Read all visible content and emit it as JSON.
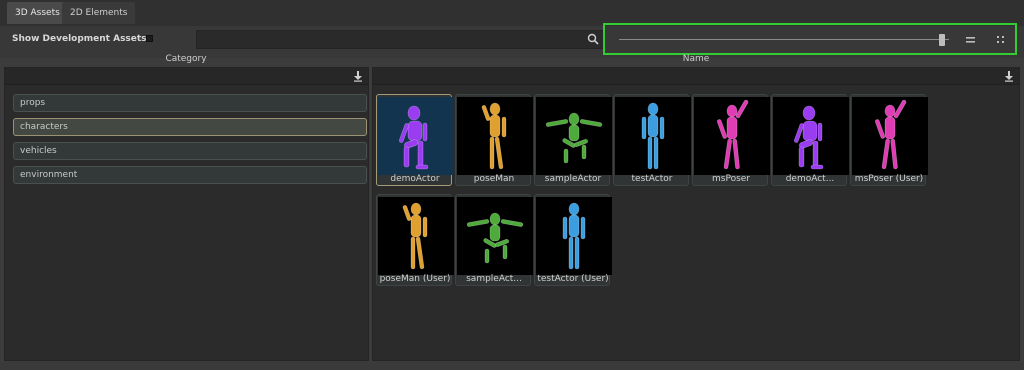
{
  "tabs": [
    {
      "label": "3D Assets",
      "active": true
    },
    {
      "label": "2D Elements",
      "active": false
    }
  ],
  "toolbar": {
    "dev_assets_label": "Show Development Assets",
    "search_value": "",
    "search_icon": "search-icon",
    "slider_value": 0.98,
    "view_list_icon": "list-view-icon",
    "view_grid_icon": "grid-view-icon",
    "highlight_color": "#33cc33"
  },
  "category_panel": {
    "header": "Category",
    "sort_icon": "sort-down-icon",
    "items": [
      {
        "label": "props",
        "selected": false
      },
      {
        "label": "characters",
        "selected": true
      },
      {
        "label": "vehicles",
        "selected": false
      },
      {
        "label": "environment",
        "selected": false
      }
    ]
  },
  "name_panel": {
    "header": "Name",
    "sort_icon": "sort-down-icon",
    "assets": [
      {
        "label": "demoActor",
        "color": "#9a3cf0",
        "pose": "crouch",
        "selected": true
      },
      {
        "label": "poseMan",
        "color": "#e0a030",
        "pose": "salute",
        "selected": false
      },
      {
        "label": "sampleActor",
        "color": "#4faa3c",
        "pose": "jump",
        "selected": false
      },
      {
        "label": "testActor",
        "color": "#3c9ee0",
        "pose": "stand",
        "selected": false
      },
      {
        "label": "msPoser",
        "color": "#e03cb4",
        "pose": "dance",
        "selected": false
      },
      {
        "label": "demoAct...",
        "color": "#9a3cf0",
        "pose": "crouch",
        "selected": false
      },
      {
        "label": "msPoser (User)",
        "color": "#e03cb4",
        "pose": "dance",
        "selected": false
      },
      {
        "label": "poseMan (User)",
        "color": "#e0a030",
        "pose": "salute",
        "selected": false
      },
      {
        "label": "sampleAct...",
        "color": "#4faa3c",
        "pose": "jump",
        "selected": false
      },
      {
        "label": "testActor (User)",
        "color": "#3c9ee0",
        "pose": "stand",
        "selected": false
      }
    ]
  }
}
